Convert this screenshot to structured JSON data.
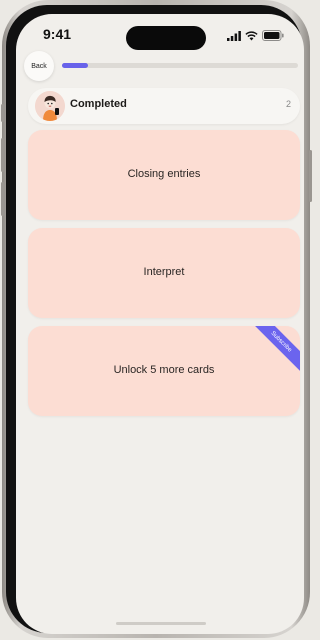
{
  "status_bar": {
    "time": "9:41"
  },
  "nav": {
    "back_label": "Back",
    "progress": 0.11,
    "accent_color": "#6862ea"
  },
  "completed": {
    "label": "Completed",
    "count": "2",
    "avatar_icon": "illustrated-person-avatar"
  },
  "cards": [
    {
      "label": "Closing entries"
    },
    {
      "label": "Interpret"
    },
    {
      "label": "Unlock 5 more cards",
      "ribbon": "Subscribe"
    }
  ],
  "colors": {
    "card_background": "#fcddd3",
    "screen_background": "#f1efeb",
    "ribbon": "#6b64ee"
  }
}
